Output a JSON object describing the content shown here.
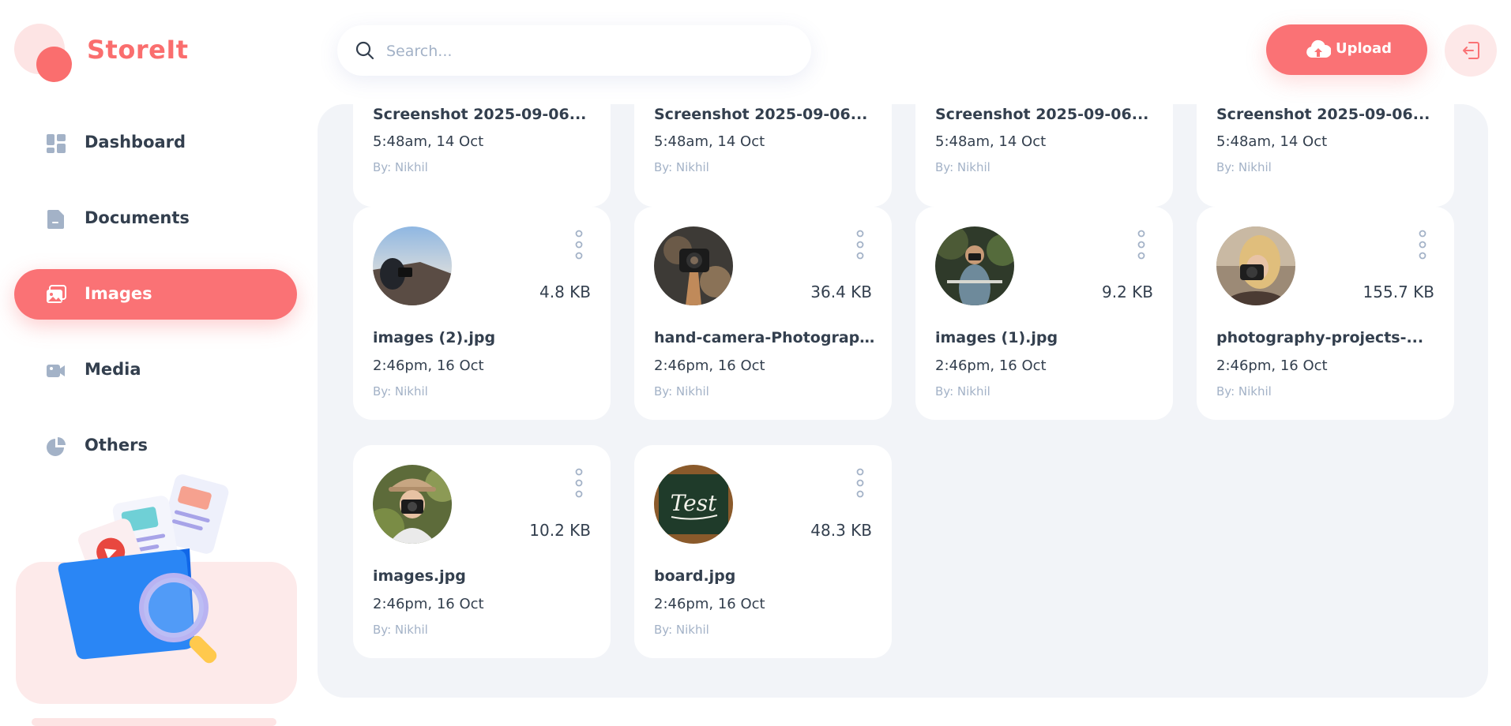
{
  "app": {
    "name": "StoreIt"
  },
  "sidebar": {
    "items": [
      {
        "label": "Dashboard",
        "icon": "dashboard-icon"
      },
      {
        "label": "Documents",
        "icon": "documents-icon"
      },
      {
        "label": "Images",
        "icon": "images-icon",
        "active": true
      },
      {
        "label": "Media",
        "icon": "media-icon"
      },
      {
        "label": "Others",
        "icon": "others-icon"
      }
    ]
  },
  "header": {
    "search_placeholder": "Search...",
    "upload_label": "Upload"
  },
  "files_top_partial": [
    {
      "name": "Screenshot 2025-09-06...",
      "date": "5:48am, 14 Oct",
      "owner": "By: Nikhil"
    },
    {
      "name": "Screenshot 2025-09-06...",
      "date": "5:48am, 14 Oct",
      "owner": "By: Nikhil"
    },
    {
      "name": "Screenshot 2025-09-06...",
      "date": "5:48am, 14 Oct",
      "owner": "By: Nikhil"
    },
    {
      "name": "Screenshot 2025-09-06...",
      "date": "5:48am, 14 Oct",
      "owner": "By: Nikhil"
    }
  ],
  "files": [
    {
      "name": "images (2).jpg",
      "size": "4.8 KB",
      "date": "2:46pm, 16 Oct",
      "owner": "By: Nikhil"
    },
    {
      "name": "hand-camera-Photography...",
      "size": "36.4 KB",
      "date": "2:46pm, 16 Oct",
      "owner": "By: Nikhil"
    },
    {
      "name": "images (1).jpg",
      "size": "9.2 KB",
      "date": "2:46pm, 16 Oct",
      "owner": "By: Nikhil"
    },
    {
      "name": "photography-projects-...",
      "size": "155.7 KB",
      "date": "2:46pm, 16 Oct",
      "owner": "By: Nikhil"
    },
    {
      "name": "images.jpg",
      "size": "10.2 KB",
      "date": "2:46pm, 16 Oct",
      "owner": "By: Nikhil"
    },
    {
      "name": "board.jpg",
      "size": "48.3 KB",
      "date": "2:46pm, 16 Oct",
      "owner": "By: Nikhil",
      "thumb_text": "Test"
    }
  ],
  "colors": {
    "brand": "#fa7275",
    "brand_light": "#fde4e4",
    "text": "#333f4e",
    "muted": "#a3b2c7",
    "surface": "#f2f4f8"
  }
}
